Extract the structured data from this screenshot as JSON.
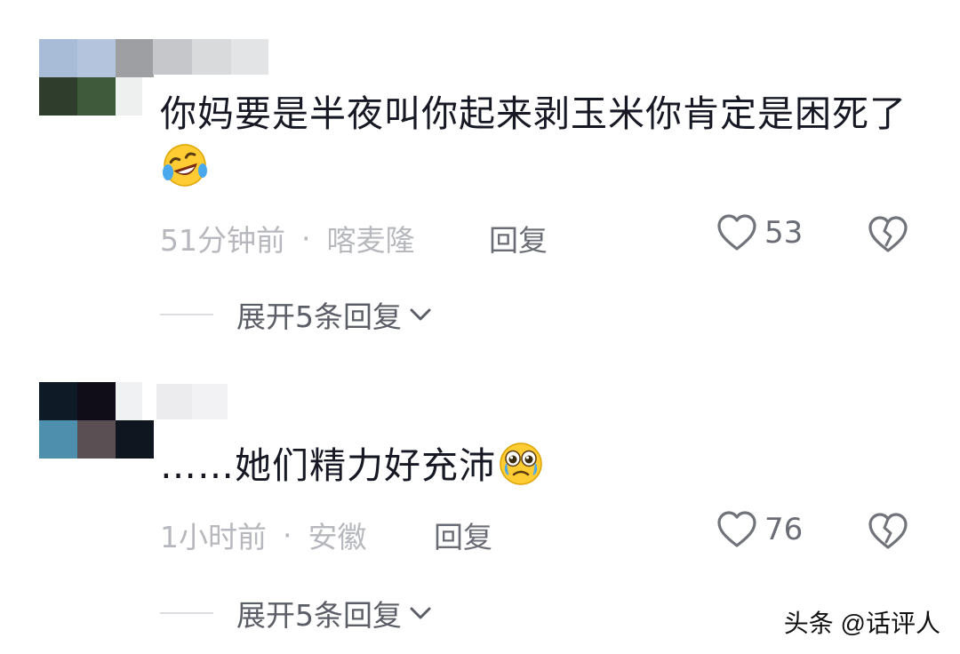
{
  "comments": [
    {
      "text": "你妈要是半夜叫你起来剥玉米你肯定是困死了",
      "emoji_icon": "laughing-crying-face-icon",
      "time": "51分钟前",
      "separator": "·",
      "location": "喀麦隆",
      "reply_label": "回复",
      "like_count": "53",
      "expand_label": "展开5条回复"
    },
    {
      "text": "……她们精力好充沛",
      "emoji_icon": "teary-eyed-face-icon",
      "time": "1小时前",
      "separator": "·",
      "location": "安徽",
      "reply_label": "回复",
      "like_count": "76",
      "expand_label": "展开5条回复"
    }
  ],
  "watermark": "头条 @话评人",
  "colors": {
    "text_primary": "#161823",
    "text_meta": "#b6b8bd",
    "text_action": "#6a6d75",
    "icon_stroke": "#707379",
    "emoji_yellow": "#ffcc33",
    "tear_blue": "#4aa8ec"
  }
}
